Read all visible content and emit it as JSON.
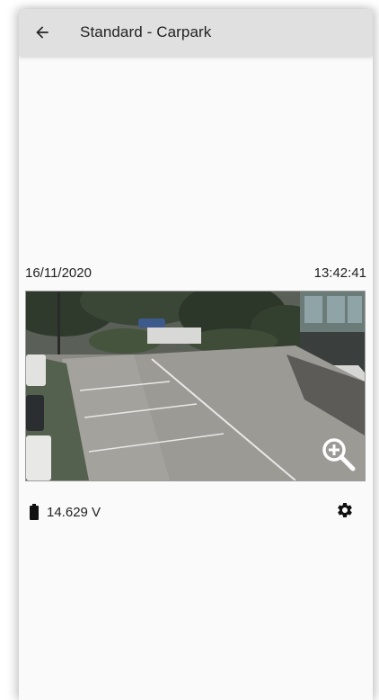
{
  "appbar": {
    "title": "Standard - Carpark",
    "back_icon": "arrow-left-icon"
  },
  "snapshot": {
    "date": "16/11/2020",
    "time": "13:42:41",
    "zoom_icon": "zoom-in-icon"
  },
  "status": {
    "battery_icon": "battery-icon",
    "voltage": "14.629 V",
    "settings_icon": "gear-icon"
  },
  "colors": {
    "appbar_bg": "#e0e0e0",
    "screen_bg": "#fafafa",
    "text": "#222222"
  }
}
